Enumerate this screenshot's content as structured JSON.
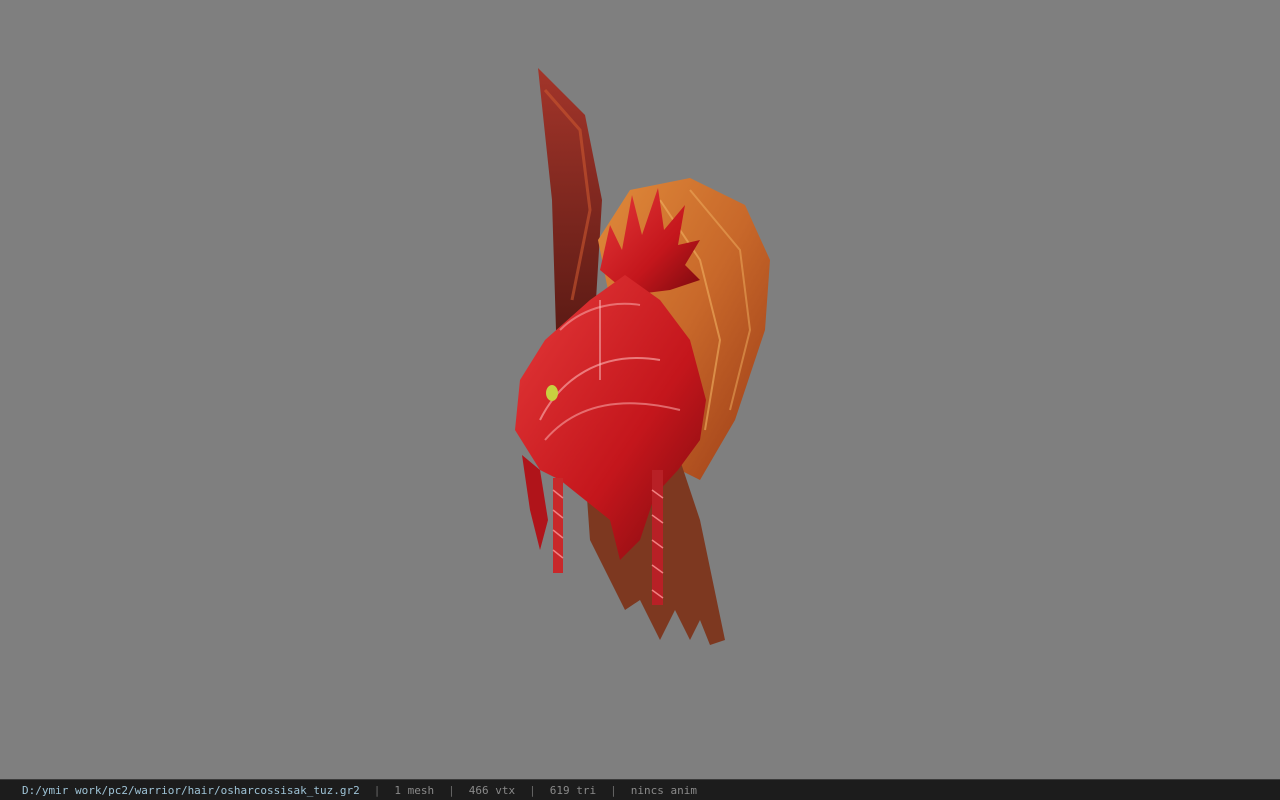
{
  "statusbar": {
    "file_path": "D:/ymir work/pc2/warrior/hair/osharcossisak_tuz.gr2",
    "separator": "|",
    "mesh_count": "1 mesh",
    "vertex_count": "466 vtx",
    "triangle_count": "619 tri",
    "animation": "nincs anim"
  },
  "colors": {
    "background": "#7f7f7f",
    "statusbar_bg": "#1c1c1c",
    "path_text": "#9ec3d6",
    "info_text": "#8a8a8a"
  }
}
